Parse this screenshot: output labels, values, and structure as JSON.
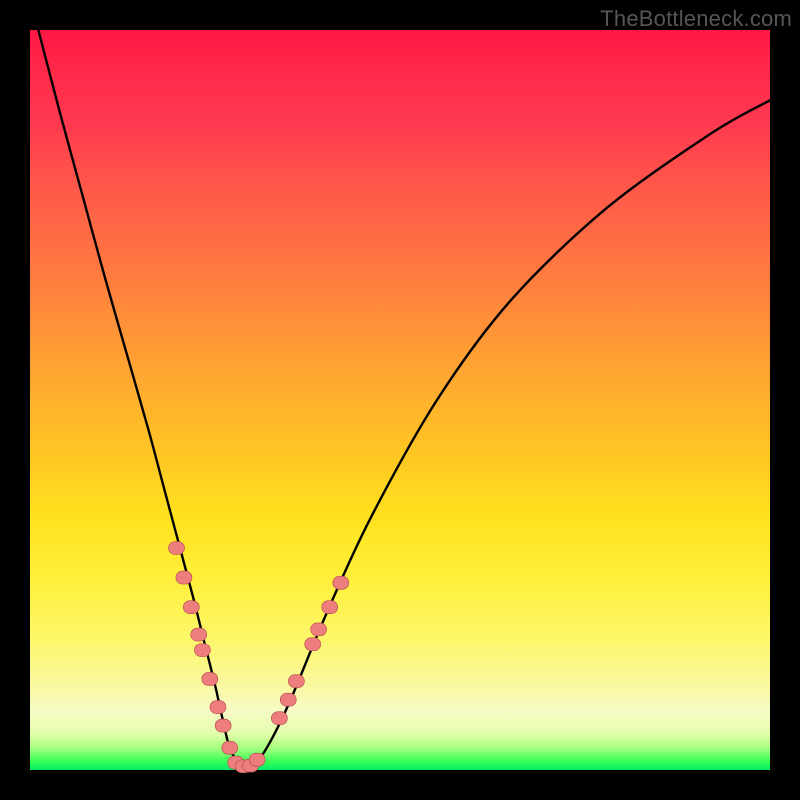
{
  "watermark": "TheBottleneck.com",
  "chart_data": {
    "type": "line",
    "title": "",
    "xlabel": "",
    "ylabel": "",
    "xlim": [
      0,
      100
    ],
    "ylim": [
      0,
      100
    ],
    "grid": false,
    "legend": false,
    "colors": {
      "curve": "#000000",
      "marker_fill": "#ee7d7d",
      "marker_stroke": "#b14a4a",
      "background_gradient_top": "#ff1744",
      "background_gradient_bottom": "#00eb6c"
    },
    "series": [
      {
        "name": "bottleneck-v-curve",
        "x_approx": [
          1,
          4,
          7,
          10,
          13,
          16,
          18,
          20,
          22,
          23.5,
          25,
          26,
          27,
          28.5,
          30,
          32,
          35,
          40,
          46,
          55,
          65,
          78,
          92,
          100
        ],
        "y_approx": [
          100.5,
          89,
          78,
          67,
          56.5,
          46,
          38.5,
          31,
          23.5,
          17.5,
          11.5,
          7,
          3,
          0.5,
          0.5,
          3,
          9,
          21,
          34,
          50,
          63.5,
          76,
          86,
          90.5
        ],
        "note": "Asymmetric V / check-mark shaped curve; minimum near x≈28, y≈0. Left branch begins slightly above the visible top (y>100) at x≈1, right branch exits the right edge near y≈90.5."
      }
    ],
    "markers": {
      "name": "highlighted-data-points",
      "style": "rounded-blob",
      "points": [
        {
          "x": 19.8,
          "y": 30.0
        },
        {
          "x": 20.8,
          "y": 26.0
        },
        {
          "x": 21.8,
          "y": 22.0
        },
        {
          "x": 22.8,
          "y": 18.3
        },
        {
          "x": 23.3,
          "y": 16.2
        },
        {
          "x": 24.3,
          "y": 12.3
        },
        {
          "x": 25.4,
          "y": 8.5
        },
        {
          "x": 26.1,
          "y": 6.0
        },
        {
          "x": 27.0,
          "y": 3.0
        },
        {
          "x": 27.8,
          "y": 1.0
        },
        {
          "x": 28.8,
          "y": 0.5
        },
        {
          "x": 29.8,
          "y": 0.6
        },
        {
          "x": 30.7,
          "y": 1.4
        },
        {
          "x": 33.7,
          "y": 7.0
        },
        {
          "x": 34.9,
          "y": 9.5
        },
        {
          "x": 36.0,
          "y": 12.0
        },
        {
          "x": 38.2,
          "y": 17.0
        },
        {
          "x": 39.0,
          "y": 19.0
        },
        {
          "x": 40.5,
          "y": 22.0
        },
        {
          "x": 42.0,
          "y": 25.3
        }
      ]
    }
  }
}
